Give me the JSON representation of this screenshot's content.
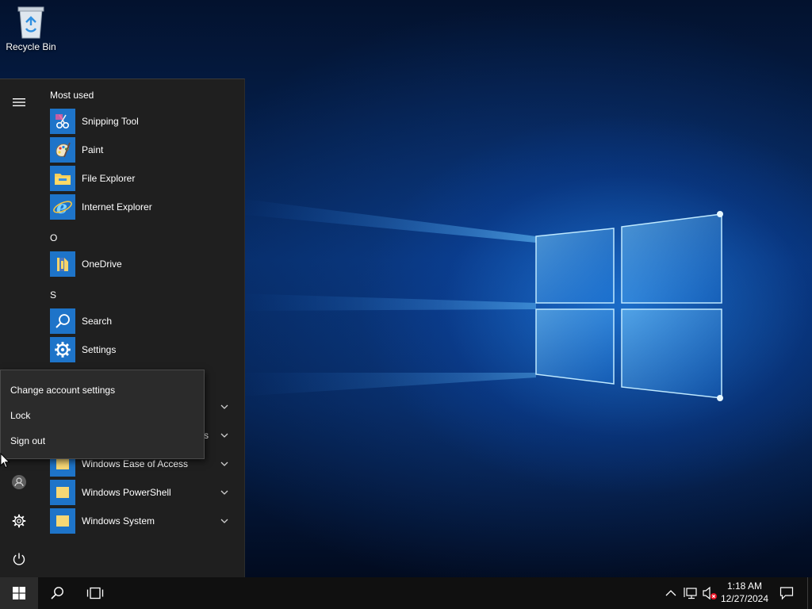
{
  "desktop": {
    "recycle_bin_label": "Recycle Bin"
  },
  "start_menu": {
    "rail": {
      "menu_icon": "hamburger-icon",
      "account_icon": "user-icon",
      "settings_icon": "gear-icon",
      "power_icon": "power-icon"
    },
    "most_used_header": "Most used",
    "most_used": [
      {
        "label": "Snipping Tool",
        "icon": "scissors-icon"
      },
      {
        "label": "Paint",
        "icon": "palette-icon"
      },
      {
        "label": "File Explorer",
        "icon": "folder-icon"
      },
      {
        "label": "Internet Explorer",
        "icon": "ie-icon"
      }
    ],
    "group_o_header": "O",
    "group_o": [
      {
        "label": "OneDrive",
        "icon": "onedrive-icon"
      }
    ],
    "group_s_header": "S",
    "group_s": [
      {
        "label": "Search",
        "icon": "search-icon"
      },
      {
        "label": "Settings",
        "icon": "gear-icon"
      }
    ],
    "partial_folder_label_tail": "s",
    "folders": [
      {
        "label": "Windows Ease of Access"
      },
      {
        "label": "Windows PowerShell"
      },
      {
        "label": "Windows System"
      }
    ]
  },
  "account_menu": {
    "items": [
      {
        "label": "Change account settings"
      },
      {
        "label": "Lock"
      },
      {
        "label": "Sign out"
      }
    ]
  },
  "taskbar": {
    "time": "1:18 AM",
    "date": "12/27/2024",
    "accent": "#1e74c9"
  }
}
